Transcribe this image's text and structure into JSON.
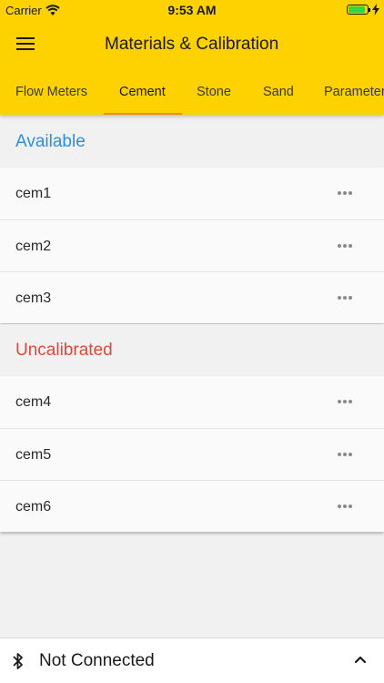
{
  "status_bar": {
    "carrier": "Carrier",
    "time": "9:53 AM",
    "battery_color": "#3ad146",
    "wifi_icon": "wifi-icon",
    "battery_icon": "battery-icon",
    "charging_icon": "charging-bolt-icon"
  },
  "toolbar": {
    "menu_icon": "hamburger-menu-icon",
    "title": "Materials & Calibration",
    "background_color": "#fdd200"
  },
  "tabs": [
    {
      "label": "Flow Meters",
      "active": false
    },
    {
      "label": "Cement",
      "active": true
    },
    {
      "label": "Stone",
      "active": false
    },
    {
      "label": "Sand",
      "active": false
    },
    {
      "label": "Parameters",
      "active": false
    }
  ],
  "tab_indicator_color": "#f08a1e",
  "sections": {
    "available": {
      "title": "Available",
      "color": "#2d8ee0",
      "items": [
        "cem1",
        "cem2",
        "cem3"
      ]
    },
    "uncalibrated": {
      "title": "Uncalibrated",
      "color": "#e0483a",
      "items": [
        "cem4",
        "cem5",
        "cem6"
      ]
    }
  },
  "row_action_icon": "more-horizontal-icon",
  "bottom_bar": {
    "bluetooth_icon": "bluetooth-icon",
    "status": "Not Connected",
    "expand_icon": "chevron-up-icon"
  }
}
